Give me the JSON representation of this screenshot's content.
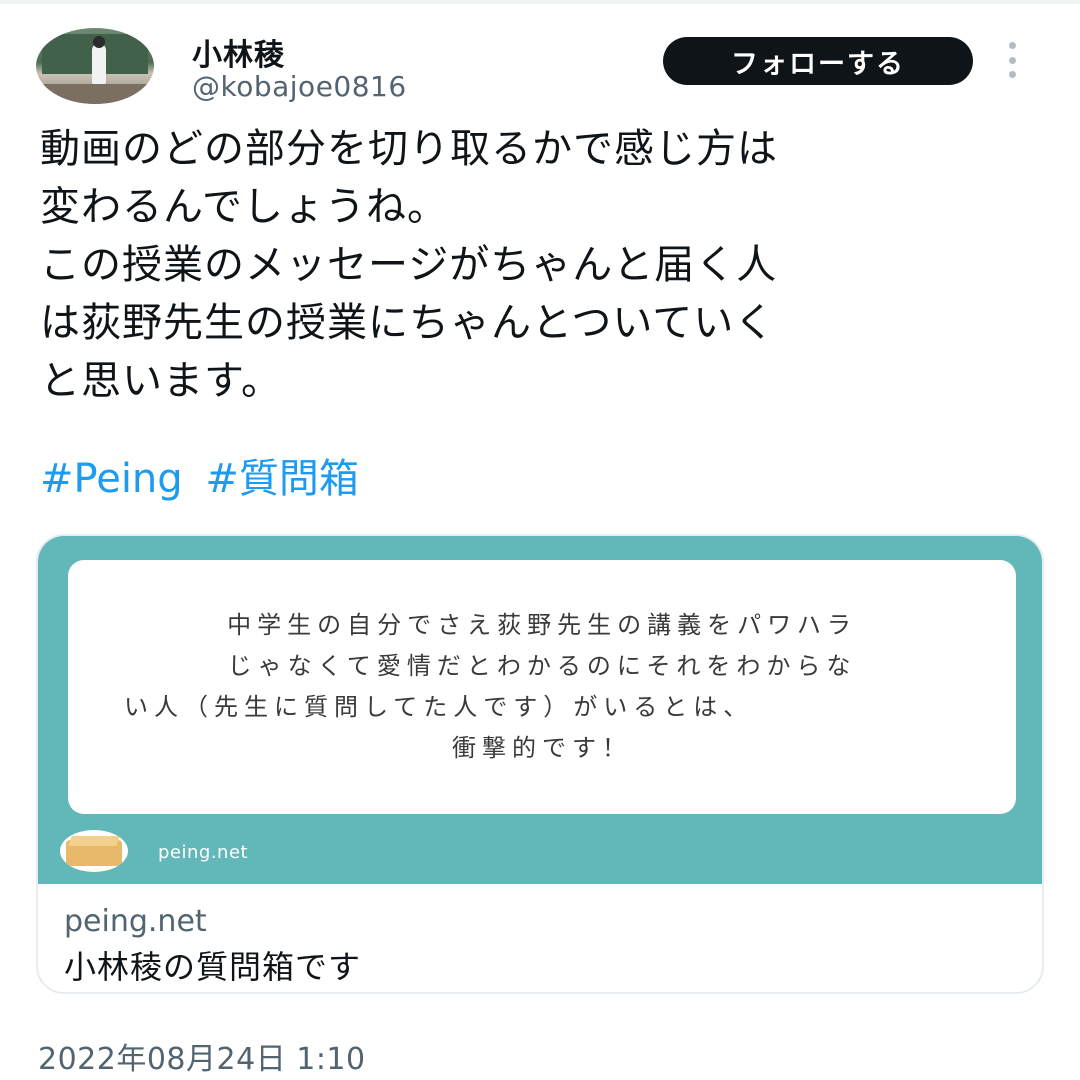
{
  "author": {
    "display_name": "小林稜",
    "handle": "@kobajoe0816",
    "avatar_icon": "profile-photo-classroom"
  },
  "actions": {
    "follow_label": "フォローする",
    "more_icon": "vertical-ellipsis-icon"
  },
  "tweet": {
    "lines": [
      "動画のどの部分を切り取るかで感じ方は",
      "変わるんでしょうね。",
      "この授業のメッセージがちゃんと届く人",
      "は荻野先生の授業にちゃんとついていく",
      "と思います。"
    ],
    "hashtags": [
      "#Peing",
      "#質問箱"
    ]
  },
  "card": {
    "question_lines": [
      "中学生の自分でさえ荻野先生の講義をパワハラ",
      "じゃなくて愛情だとわかるのにそれをわからな",
      "い人（先生に質問してた人です）がいるとは、",
      "衝撃的です！"
    ],
    "image_brand": "peing.net",
    "domain": "peing.net",
    "title": "小林稜の質問箱です",
    "colors": {
      "teal": "#62b8b8"
    }
  },
  "timestamp": "2022年08月24日 1:10",
  "colors": {
    "link": "#1d9bf0",
    "text": "#0f1419",
    "muted": "#536471"
  }
}
